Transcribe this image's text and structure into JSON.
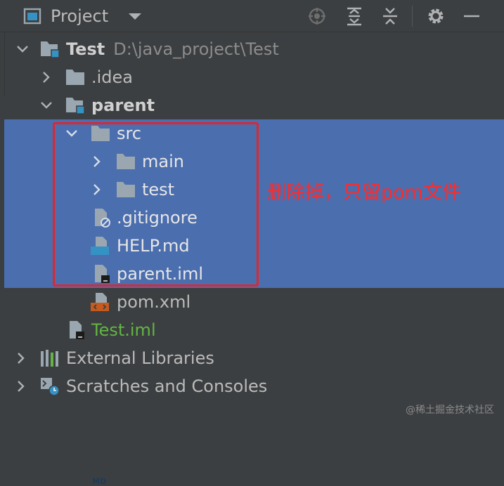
{
  "header": {
    "title": "Project",
    "icons": [
      "project-window-icon",
      "dropdown-chevron-icon",
      "locate-icon",
      "expand-all-icon",
      "collapse-all-icon",
      "gear-icon",
      "hide-icon"
    ]
  },
  "tree": {
    "root": {
      "label": "Test",
      "path": "D:\\java_project\\Test"
    },
    "idea": {
      "label": ".idea"
    },
    "parent": {
      "label": "parent"
    },
    "src": {
      "label": "src"
    },
    "main": {
      "label": "main"
    },
    "test": {
      "label": "test"
    },
    "gitignore": {
      "label": ".gitignore"
    },
    "help": {
      "label": "HELP.md",
      "badge": "MD"
    },
    "parent_iml": {
      "label": "parent.iml"
    },
    "pom": {
      "label": "pom.xml"
    },
    "test_iml": {
      "label": "Test.iml"
    },
    "external": {
      "label": "External Libraries"
    },
    "scratches": {
      "label": "Scratches and Consoles"
    }
  },
  "annotation": {
    "text": "删除掉，只留pom文件"
  },
  "watermark": "@稀土掘金技术社区",
  "colors": {
    "background": "#3c3f41",
    "selection": "#4b6eaf",
    "folder": "#9aa7b0",
    "annotation": "#ff2a2a",
    "iml_green": "#62b543",
    "module_badge": "#3592c4",
    "xml_badge": "#c75a1e"
  }
}
